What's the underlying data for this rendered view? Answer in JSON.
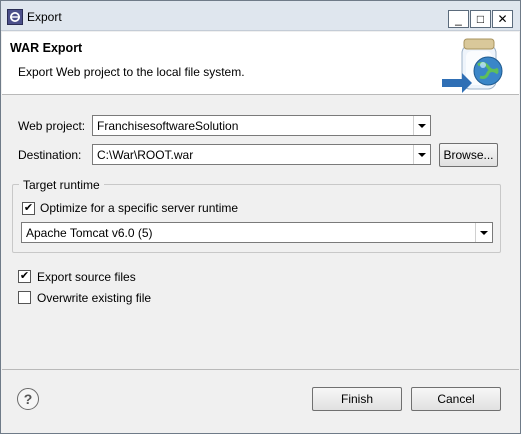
{
  "window": {
    "title": "Export",
    "minimize_glyph": "_",
    "maximize_glyph": "□",
    "close_glyph": "✕"
  },
  "header": {
    "title": "WAR Export",
    "subtitle": "Export Web project to the local file system.",
    "icon": "war-export-wizard-icon"
  },
  "form": {
    "web_project_label": "Web project:",
    "web_project_value": "FranchisesoftwareSolution",
    "destination_label": "Destination:",
    "destination_value": "C:\\War\\ROOT.war",
    "browse_label": "Browse..."
  },
  "target_runtime": {
    "legend": "Target runtime",
    "optimize_label": "Optimize for a specific server runtime",
    "optimize_checked": true,
    "runtime_value": "Apache Tomcat v6.0 (5)"
  },
  "options": {
    "export_source_label": "Export source files",
    "export_source_checked": true,
    "overwrite_label": "Overwrite existing file",
    "overwrite_checked": false
  },
  "footer": {
    "help_glyph": "?",
    "finish_label": "Finish",
    "cancel_label": "Cancel"
  },
  "colors": {
    "dialog_bg": "#f0f0f0",
    "header_bg": "#ffffff",
    "title_bar_bg": "#dfe6ee"
  }
}
